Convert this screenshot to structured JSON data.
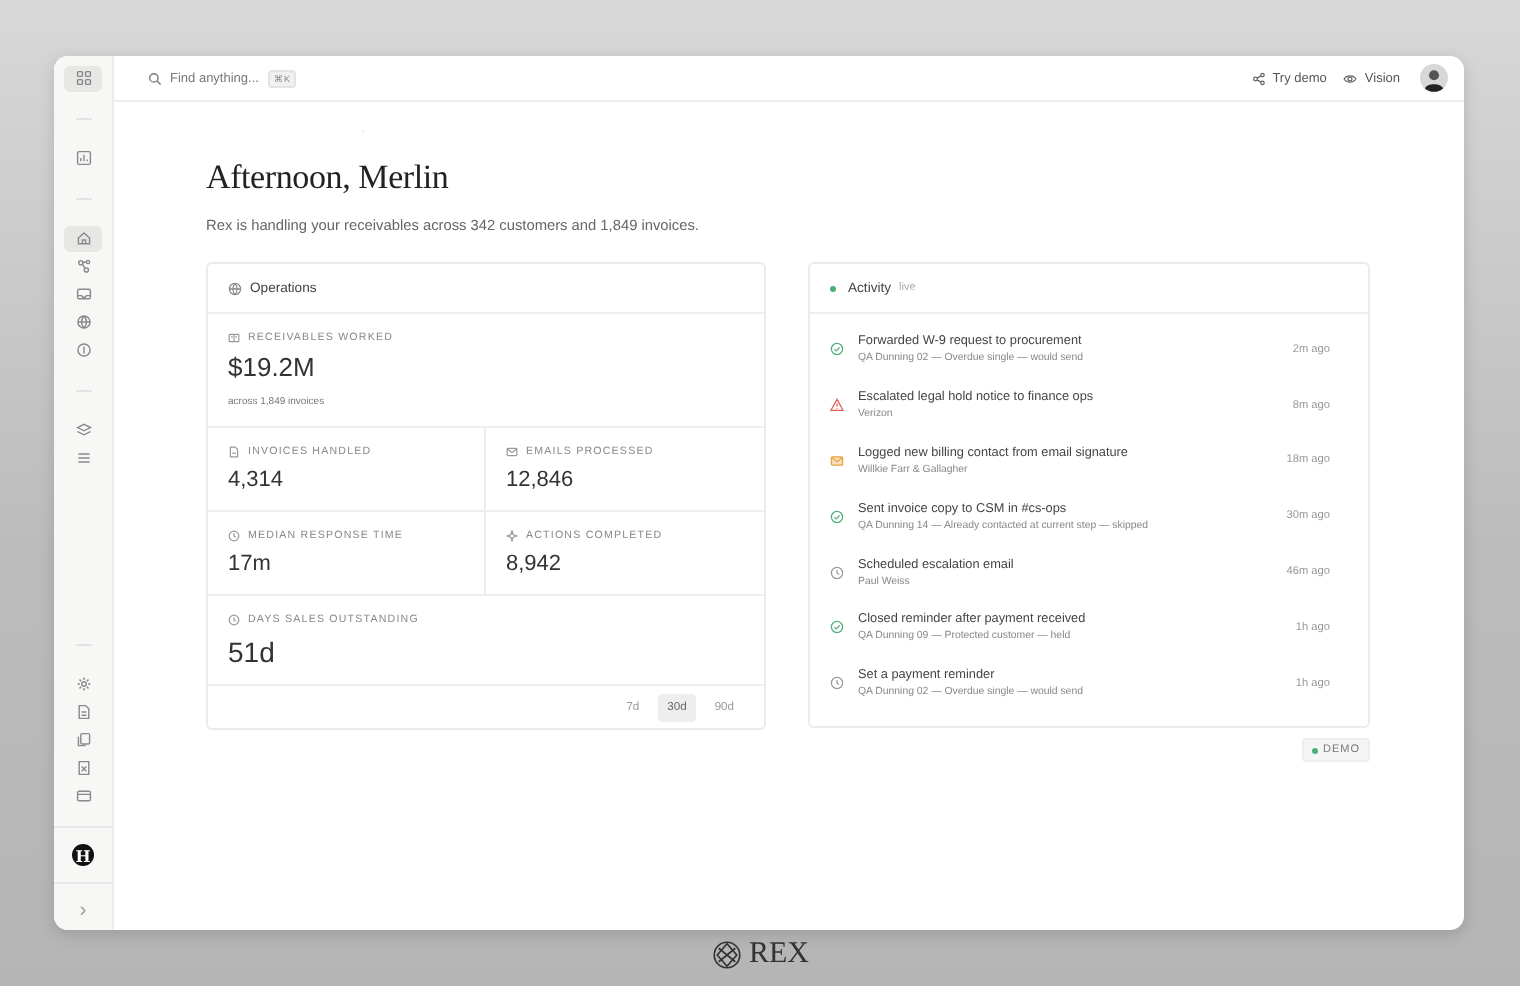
{
  "sidebar": {
    "top": [
      {
        "selected": true
      }
    ],
    "groups": [
      [
        {
          "selected": false
        }
      ],
      [
        {
          "selected": true
        },
        {
          "selected": false
        },
        {
          "selected": false
        },
        {
          "selected": false
        },
        {
          "selected": false
        }
      ],
      [
        {
          "selected": false
        },
        {
          "selected": false
        }
      ]
    ],
    "bottom": [
      {
        "selected": false
      },
      {
        "selected": false
      },
      {
        "selected": false
      },
      {
        "selected": false
      },
      {
        "selected": false
      }
    ],
    "workspace_initial": "H",
    "collapse": "›"
  },
  "topbar": {
    "search": {
      "placeholder": "Find anything...",
      "shortcut": "⌘K"
    },
    "actions": [
      {
        "label": "Try demo",
        "kind": "demo"
      },
      {
        "label": "Vision",
        "kind": "vision"
      }
    ]
  },
  "greeting": {
    "title": "Afternoon, Merlin",
    "subtitle": "Rex is handling your receivables across 342 customers and 1,849 invoices."
  },
  "operations": {
    "title": "Operations",
    "hero": {
      "label": "RECEIVABLES WORKED",
      "value": "$19.2M",
      "note": "across 1,849 invoices"
    },
    "metrics": [
      {
        "label": "INVOICES HANDLED",
        "value": "4,314",
        "kind": "invoice"
      },
      {
        "label": "EMAILS PROCESSED",
        "value": "12,846",
        "kind": "mail"
      },
      {
        "label": "MEDIAN RESPONSE TIME",
        "value": "17m",
        "kind": "clock"
      },
      {
        "label": "ACTIONS COMPLETED",
        "value": "8,942",
        "kind": "spark"
      }
    ],
    "dso": {
      "label": "DAYS SALES OUTSTANDING",
      "value": "51d"
    },
    "ranges": [
      {
        "label": "7d",
        "selected": false
      },
      {
        "label": "30d",
        "selected": true
      },
      {
        "label": "90d",
        "selected": false
      }
    ]
  },
  "activity": {
    "title": "Activity",
    "status": "live",
    "items": [
      {
        "title": "Forwarded W-9 request to procurement",
        "detail": "QA Dunning 02 — Overdue single — would send",
        "time": "2m ago",
        "kind": "done"
      },
      {
        "title": "Escalated legal hold notice to finance ops",
        "detail": "Verizon",
        "time": "8m ago",
        "kind": "warning"
      },
      {
        "title": "Logged new billing contact from email signature",
        "detail": "Willkie Farr & Gallagher",
        "time": "18m ago",
        "kind": "mail"
      },
      {
        "title": "Sent invoice copy to CSM in #cs-ops",
        "detail": "QA Dunning 14 — Already contacted at current step — skipped",
        "time": "30m ago",
        "kind": "done"
      },
      {
        "title": "Scheduled escalation email",
        "detail": "Paul Weiss",
        "time": "46m ago",
        "kind": "scheduled"
      },
      {
        "title": "Closed reminder after payment received",
        "detail": "QA Dunning 09 — Protected customer — held",
        "time": "1h ago",
        "kind": "done"
      },
      {
        "title": "Set a payment reminder",
        "detail": "QA Dunning 02 — Overdue single — would send",
        "time": "1h ago",
        "kind": "scheduled"
      }
    ]
  },
  "demo_badge": "DEMO",
  "brand": "REX"
}
